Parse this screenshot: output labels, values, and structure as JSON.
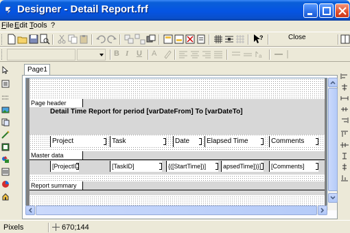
{
  "window": {
    "title": "Designer - Detail Report.frf"
  },
  "menu": {
    "file": "File",
    "edit": "Edit",
    "tools": "Tools",
    "help": "?"
  },
  "toolbar": {
    "close_label": "Close",
    "format_glyphs": [
      "B",
      "I",
      "U",
      "A"
    ]
  },
  "tabs": [
    "Page1"
  ],
  "bands": {
    "page_header": "Page header",
    "master_data": "Master data",
    "report_summary": "Report summary"
  },
  "report": {
    "title": "Detail Time Report for period [varDateFrom] To [varDateTo]",
    "column_headers": [
      "Project",
      "Task",
      "Date",
      "Elapsed Time",
      "Comments"
    ],
    "data_fields": [
      "[ProjectID]",
      "[TaskID]",
      "{([StartTime])]",
      "apsedTime])}]",
      "[Comments]"
    ]
  },
  "status": {
    "units": "Pixels",
    "coordinates": "670;144"
  },
  "colors": {
    "titlebar": "#0554e3",
    "chrome": "#ece9d8",
    "band_fill": "#d7d7d7"
  }
}
